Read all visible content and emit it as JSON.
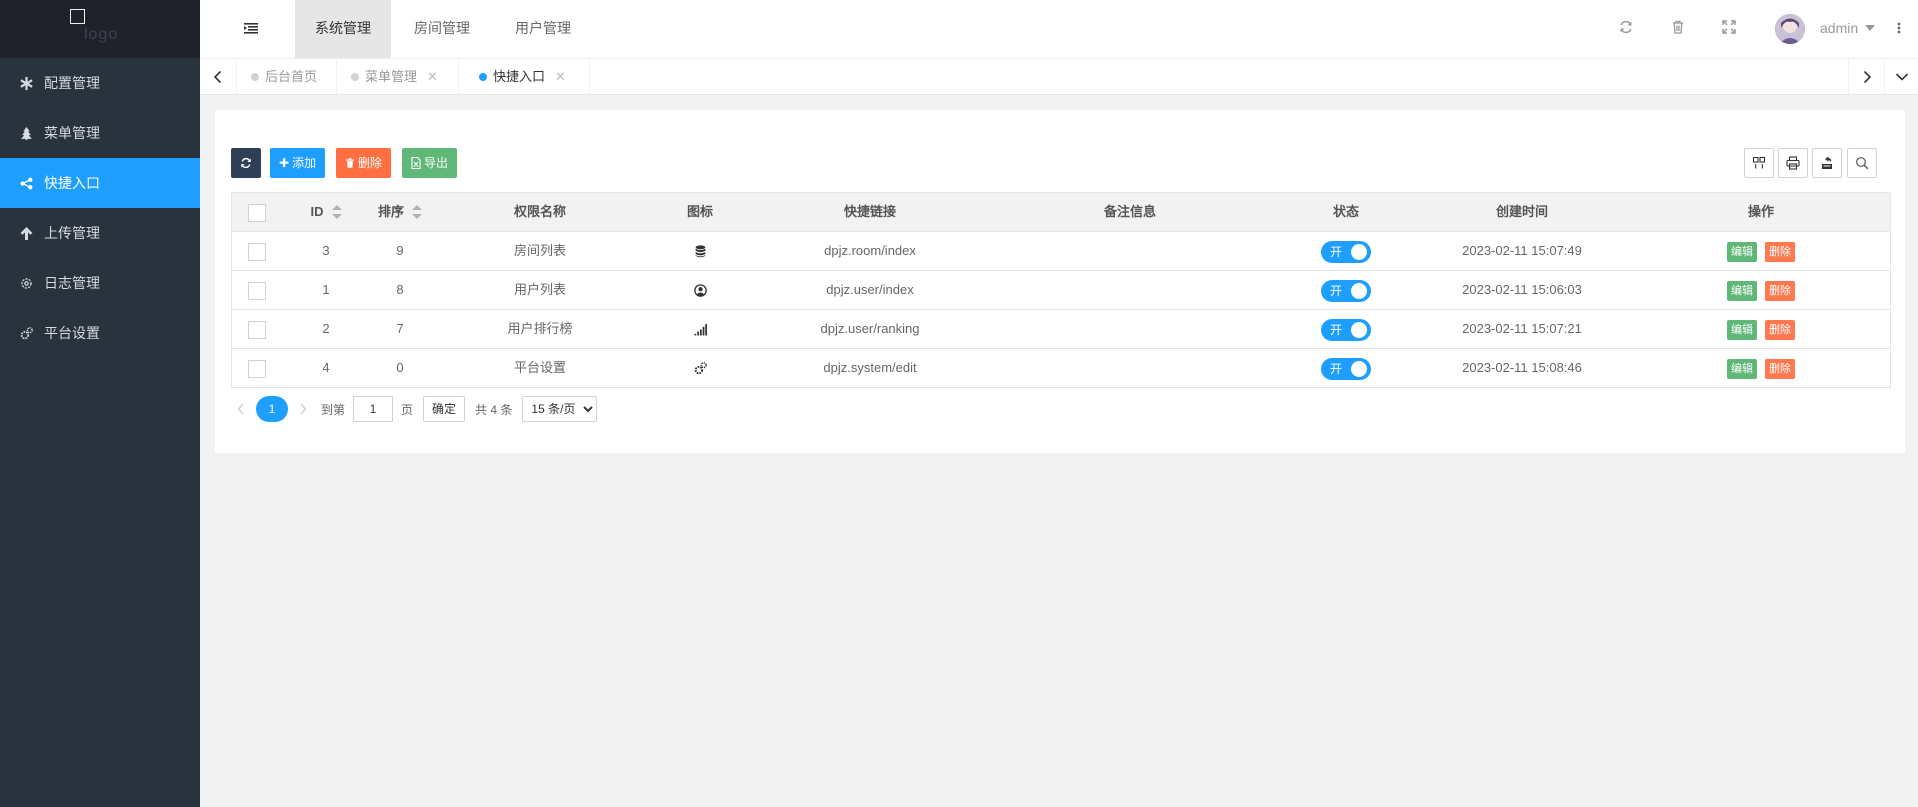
{
  "sidebar": {
    "logo_text": "logo",
    "items": [
      {
        "label": "配置管理",
        "icon": "asterisk-icon"
      },
      {
        "label": "菜单管理",
        "icon": "tree-icon"
      },
      {
        "label": "快捷入口",
        "icon": "share-icon",
        "active": true
      },
      {
        "label": "上传管理",
        "icon": "arrow-up-icon"
      },
      {
        "label": "日志管理",
        "icon": "gear-icon"
      },
      {
        "label": "平台设置",
        "icon": "gears-icon"
      }
    ]
  },
  "header": {
    "top_tabs": [
      "系统管理",
      "房间管理",
      "用户管理"
    ],
    "active_tab": "系统管理",
    "username": "admin"
  },
  "page_tabs": [
    {
      "label": "后台首页",
      "closable": false
    },
    {
      "label": "菜单管理",
      "closable": true
    },
    {
      "label": "快捷入口",
      "closable": true,
      "active": true
    }
  ],
  "toolbar": {
    "add_label": "添加",
    "delete_label": "删除",
    "export_label": "导出"
  },
  "table": {
    "columns": [
      "ID",
      "排序",
      "权限名称",
      "图标",
      "快捷链接",
      "备注信息",
      "状态",
      "创建时间",
      "操作"
    ],
    "rows": [
      {
        "id": "3",
        "sort": "9",
        "name": "房间列表",
        "icon": "database-icon",
        "link": "dpjz.room/index",
        "remark": "",
        "status": "开",
        "created": "2023-02-11 15:07:49"
      },
      {
        "id": "1",
        "sort": "8",
        "name": "用户列表",
        "icon": "user-circle-icon",
        "link": "dpjz.user/index",
        "remark": "",
        "status": "开",
        "created": "2023-02-11 15:06:03"
      },
      {
        "id": "2",
        "sort": "7",
        "name": "用户排行榜",
        "icon": "signal-icon",
        "link": "dpjz.user/ranking",
        "remark": "",
        "status": "开",
        "created": "2023-02-11 15:07:21"
      },
      {
        "id": "4",
        "sort": "0",
        "name": "平台设置",
        "icon": "gears-icon",
        "link": "dpjz.system/edit",
        "remark": "",
        "status": "开",
        "created": "2023-02-11 15:08:46"
      }
    ],
    "edit_label": "编辑",
    "delete_label": "删除"
  },
  "pagination": {
    "current_page": "1",
    "goto_prefix": "到第",
    "goto_value": "1",
    "goto_suffix": "页",
    "confirm_label": "确定",
    "total_text": "共 4 条",
    "page_size_option": "15 条/页"
  },
  "colors": {
    "primary": "#1e9fff",
    "sidebar_bg": "#28333e",
    "danger": "#ff5722",
    "success": "#5fb878"
  }
}
